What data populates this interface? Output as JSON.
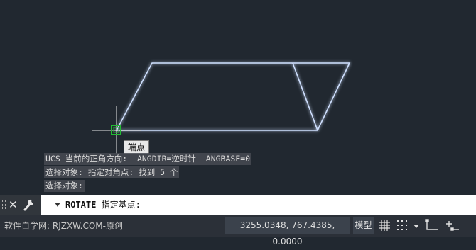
{
  "drawing": {
    "tooltip": "端点",
    "colors": {
      "background": "#212830",
      "lines": "#cfe0ff",
      "glow": "#3a6fd8",
      "snap_marker": "#22bb33"
    }
  },
  "history": [
    "UCS 当前的正角方向:  ANGDIR=逆时针  ANGBASE=0",
    "选择对象: 指定对角点: 找到 5 个",
    "选择对象:"
  ],
  "command": {
    "name": "ROTATE",
    "prompt": " 指定基点:"
  },
  "status": {
    "watermark": "软件自学网: RJZXW.COM-原创",
    "coordinates": "3255.0348, 767.4385, 0.0000",
    "model_label": "模型"
  },
  "icons": [
    "close-icon",
    "wrench-icon",
    "grid-icon",
    "snap-grid-icon",
    "ortho-icon",
    "polar-icon",
    "dropdown-arrow-icon"
  ]
}
